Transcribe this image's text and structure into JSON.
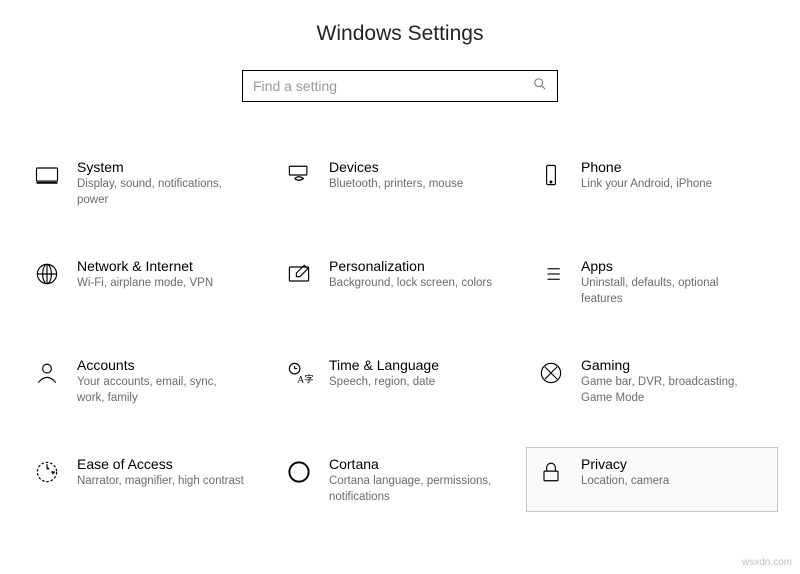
{
  "page_title": "Windows Settings",
  "search": {
    "placeholder": "Find a setting"
  },
  "tiles": [
    {
      "key": "system",
      "title": "System",
      "desc": "Display, sound, notifications, power",
      "highlighted": false
    },
    {
      "key": "devices",
      "title": "Devices",
      "desc": "Bluetooth, printers, mouse",
      "highlighted": false
    },
    {
      "key": "phone",
      "title": "Phone",
      "desc": "Link your Android, iPhone",
      "highlighted": false
    },
    {
      "key": "network",
      "title": "Network & Internet",
      "desc": "Wi-Fi, airplane mode, VPN",
      "highlighted": false
    },
    {
      "key": "personalization",
      "title": "Personalization",
      "desc": "Background, lock screen, colors",
      "highlighted": false
    },
    {
      "key": "apps",
      "title": "Apps",
      "desc": "Uninstall, defaults, optional features",
      "highlighted": false
    },
    {
      "key": "accounts",
      "title": "Accounts",
      "desc": "Your accounts, email, sync, work, family",
      "highlighted": false
    },
    {
      "key": "time",
      "title": "Time & Language",
      "desc": "Speech, region, date",
      "highlighted": false
    },
    {
      "key": "gaming",
      "title": "Gaming",
      "desc": "Game bar, DVR, broadcasting, Game Mode",
      "highlighted": false
    },
    {
      "key": "ease",
      "title": "Ease of Access",
      "desc": "Narrator, magnifier, high contrast",
      "highlighted": false
    },
    {
      "key": "cortana",
      "title": "Cortana",
      "desc": "Cortana language, permissions, notifications",
      "highlighted": false
    },
    {
      "key": "privacy",
      "title": "Privacy",
      "desc": "Location, camera",
      "highlighted": true
    }
  ],
  "watermark": "wsxdn.com"
}
